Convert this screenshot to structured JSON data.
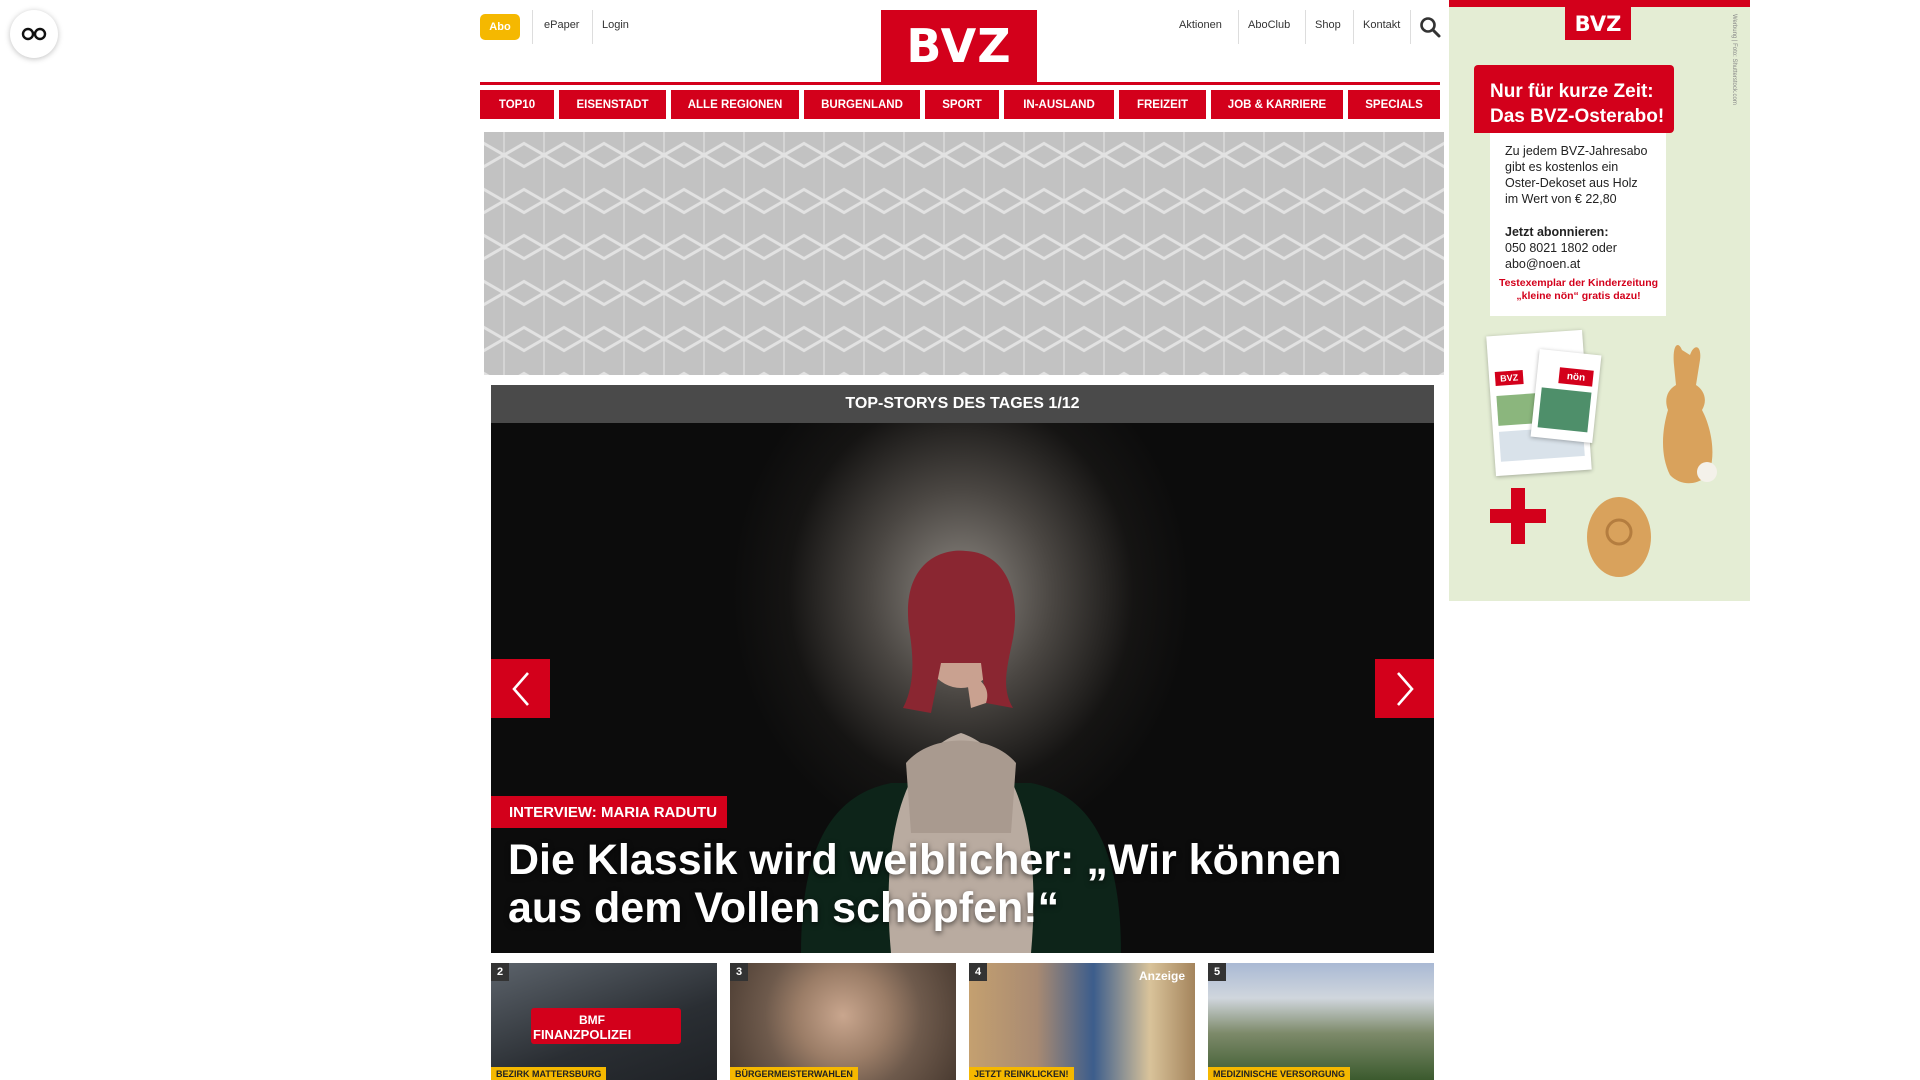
{
  "header": {
    "abo_label": "Abo",
    "epaper_label": "ePaper",
    "login_label": "Login",
    "logo_text": "BVZ",
    "aktionen_label": "Aktionen",
    "aboclub_label": "AboClub",
    "shop_label": "Shop",
    "kontakt_label": "Kontakt",
    "search_icon": "search-icon",
    "accessibility_icon": "glasses-icon"
  },
  "nav": {
    "items": [
      "TOP10",
      "EISENSTADT",
      "ALLE REGIONEN",
      "BURGENLAND",
      "SPORT",
      "IN-AUSLAND",
      "FREIZEIT",
      "JOB & KARRIERE",
      "SPECIALS"
    ]
  },
  "stories": {
    "header": "TOP-STORYS DES TAGES 1/12",
    "kicker": "INTERVIEW: MARIA RADUTU",
    "headline": "Die Klassik wird weiblicher: „Wir können aus dem Vollen schöpfen!“",
    "prev_icon": "chevron-left-icon",
    "next_icon": "chevron-right-icon"
  },
  "thumbnails": [
    {
      "num": "2",
      "tag": "BEZIRK MATTERSBURG",
      "image_text": "FINANZPOLIZEI",
      "image_badge": "BMF"
    },
    {
      "num": "3",
      "tag": "BÜRGERMEISTERWAHLEN"
    },
    {
      "num": "4",
      "tag": "JETZT REINKLICKEN!",
      "badge": "Anzeige"
    },
    {
      "num": "5",
      "tag": "MEDIZINISCHE VERSORGUNG"
    }
  ],
  "ad": {
    "logo": "BVZ",
    "headline_1": "Nur für kurze Zeit:",
    "headline_2": "Das BVZ-Osterabo!",
    "body_1": "Zu jedem BVZ-Jahresabo",
    "body_2": "gibt es kostenlos ein",
    "body_3": "Oster-Dekoset aus Holz",
    "body_4": "im Wert von € 22,80",
    "cta": "Jetzt abonnieren:",
    "phone": "050 8021 1802 oder",
    "email": "abo@noen.at",
    "promo_1": "Testexemplar der Kinderzeitung",
    "promo_2": "„kleine nön“ gratis dazu!",
    "credit": "Werbung | Foto: Shutterstock.com",
    "paper_logo": "BVZ",
    "kids_logo": "nön",
    "accent": "#d3001b"
  },
  "colors": {
    "brand_red": "#d3001b",
    "abo_yellow": "#f5b800",
    "story_header": "#4a4a4a"
  }
}
